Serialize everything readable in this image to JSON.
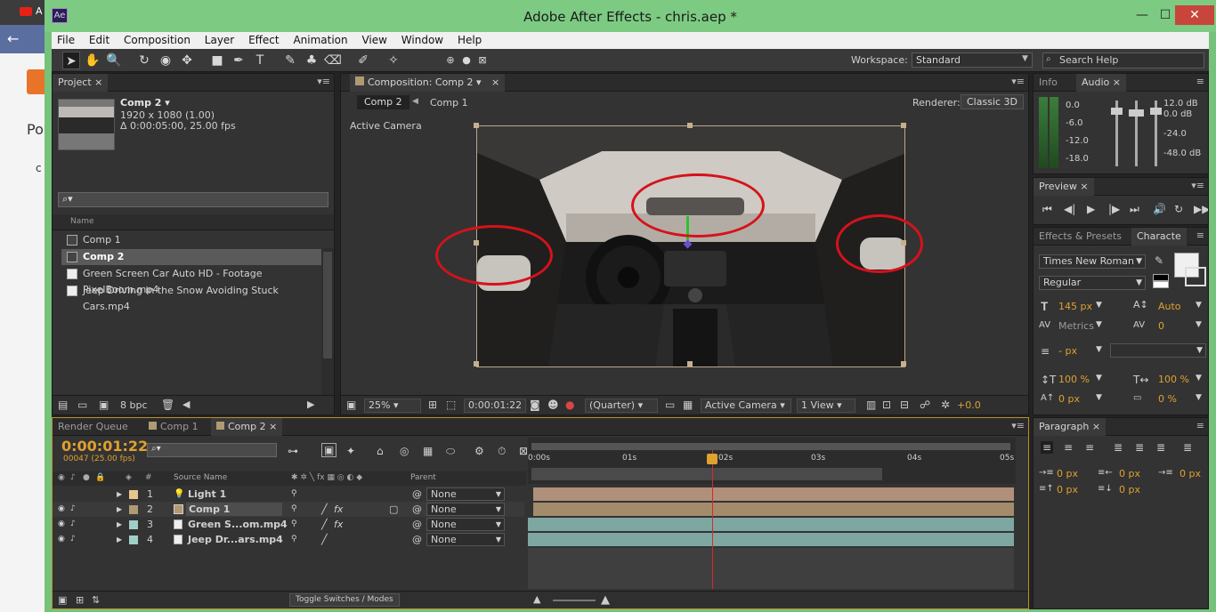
{
  "browser": {
    "tab_text": "A",
    "page_text_1": "Po",
    "page_text_2": "c"
  },
  "window": {
    "title": "Adobe After Effects - chris.aep *",
    "app_badge": "Ae",
    "minimize": "—",
    "maximize": "☐",
    "close": "✕"
  },
  "menu": [
    "File",
    "Edit",
    "Composition",
    "Layer",
    "Effect",
    "Animation",
    "View",
    "Window",
    "Help"
  ],
  "toolbar": {
    "workspace_label": "Workspace:",
    "workspace_value": "Standard",
    "search_placeholder": "Search Help"
  },
  "project": {
    "tab": "Project",
    "comp_name": "Comp 2 ▾",
    "comp_res": "1920 x 1080 (1.00)",
    "comp_duration": "Δ 0:00:05:00, 25.00 fps",
    "col_name": "Name",
    "items": [
      "Comp 1",
      "Comp 2",
      "Green Screen Car Auto HD - Footage PixelBoom.mp4",
      "Jeep Driving in the Snow Avoiding Stuck Cars.mp4"
    ],
    "bpc": "8 bpc"
  },
  "composition": {
    "tab": "Composition: Comp 2",
    "breadcrumb_active": "Comp 2",
    "breadcrumb_other": "Comp 1",
    "renderer_label": "Renderer:",
    "renderer_value": "Classic 3D",
    "camera_label": "Active Camera",
    "footer": {
      "zoom": "25%",
      "timecode": "0:00:01:22",
      "resolution": "(Quarter)",
      "camera": "Active Camera",
      "views": "1 View",
      "exposure": "+0.0"
    }
  },
  "info_audio": {
    "tab_info": "Info",
    "tab_audio": "Audio",
    "left_scale": [
      "0.0",
      "-6.0",
      "-12.0",
      "-18.0"
    ],
    "right_scale": [
      "12.0 dB",
      "0.0 dB",
      "-24.0",
      "-48.0 dB"
    ]
  },
  "preview": {
    "tab": "Preview"
  },
  "character": {
    "tab_effects": "Effects & Presets",
    "tab_character": "Characte",
    "font": "Times New Roman",
    "style": "Regular",
    "size": "145 px",
    "leading": "Auto",
    "kerning": "Metrics",
    "tracking": "0",
    "stroke": "- px",
    "vscale": "100 %",
    "hscale": "100 %",
    "baseline": "0 px",
    "tsume": "0 %"
  },
  "paragraph": {
    "tab": "Paragraph",
    "indent_left": "0 px",
    "indent_right": "0 px",
    "indent_first": "0 px",
    "space_before": "0 px",
    "space_after": "0 px"
  },
  "timeline": {
    "tab_render": "Render Queue",
    "tab_comp1": "Comp 1",
    "tab_comp2": "Comp 2",
    "timecode": "0:00:01:22",
    "frame_info": "00047 (25.00 fps)",
    "col_source": "Source Name",
    "col_parent": "Parent",
    "ruler": [
      "0:00s",
      "01s",
      "02s",
      "03s",
      "04s",
      "05s"
    ],
    "layers": [
      {
        "num": "1",
        "name": "Light 1",
        "parent": "None"
      },
      {
        "num": "2",
        "name": "Comp 1",
        "parent": "None"
      },
      {
        "num": "3",
        "name": "Green S...om.mp4",
        "parent": "None"
      },
      {
        "num": "4",
        "name": "Jeep Dr...ars.mp4",
        "parent": "None"
      }
    ],
    "toggle_label": "Toggle Switches / Modes"
  }
}
